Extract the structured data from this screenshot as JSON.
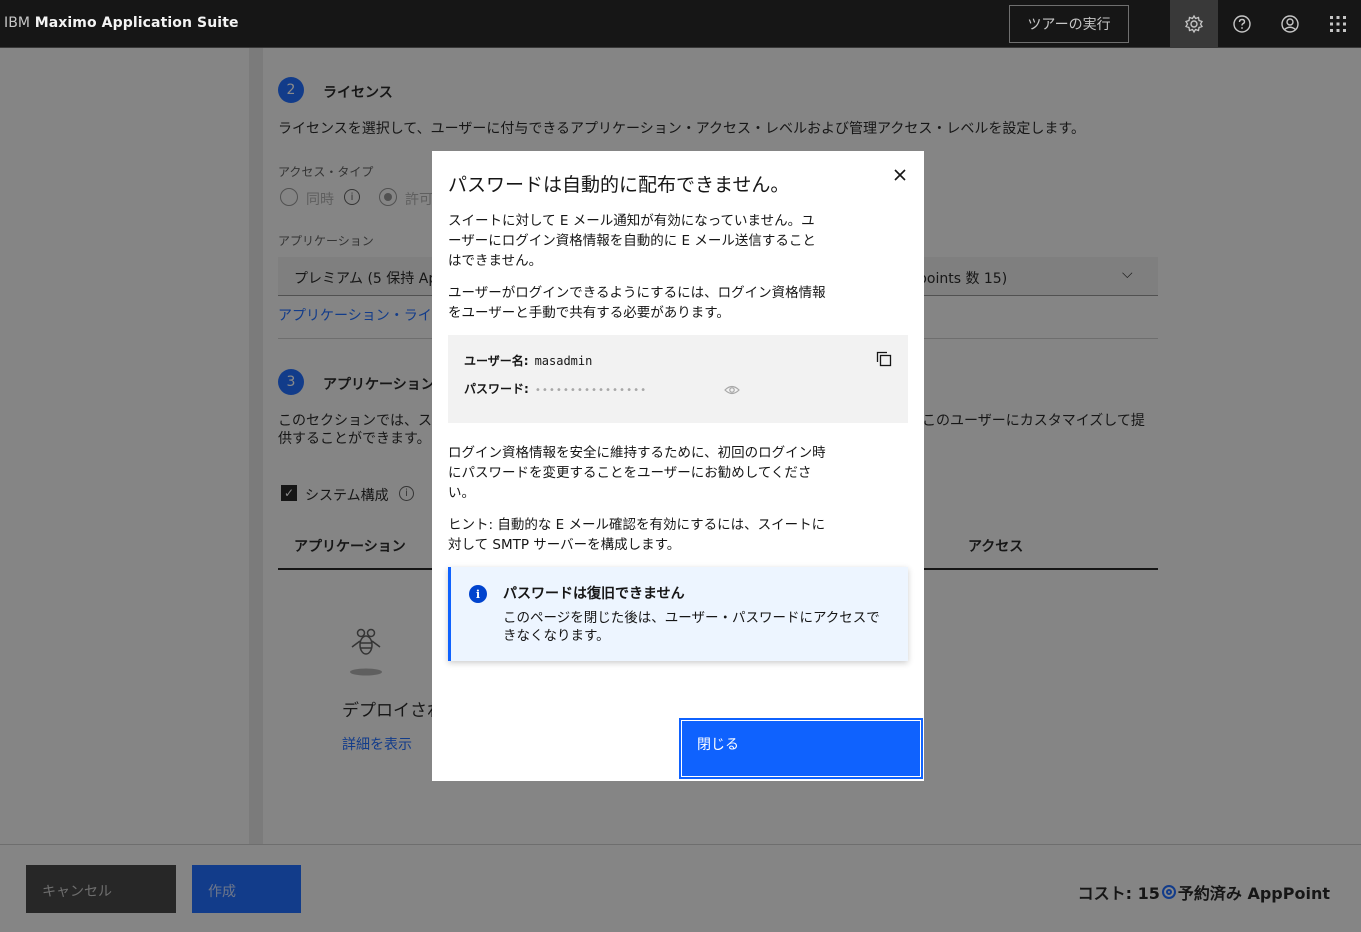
{
  "header": {
    "brand_prefix": "IBM",
    "brand_name": "Maximo Application Suite",
    "tour_button": "ツアーの実行"
  },
  "license_section": {
    "step": "2",
    "title": "ライセンス",
    "description": "ライセンスを選択して、ユーザーに付与できるアプリケーション・アクセス・レベルおよび管理アクセス・レベルを設定します。",
    "access_type_label": "アクセス・タイプ",
    "access_type_options": [
      "同時",
      "許可"
    ],
    "application_label": "アプリケーション",
    "application_value_left": "プレミアム (5 保持 Ap",
    "application_value_right": "points 数 15)",
    "app_license_link": "アプリケーション・ライ"
  },
  "application_section": {
    "step": "3",
    "title": "アプリケーション",
    "description_left_1": "このセクションでは、ス",
    "description_left_2": "供することができます。",
    "description_right": "このユーザーにカスタマイズして提",
    "system_config_label": "システム構成",
    "column_application": "アプリケーション",
    "column_access": "アクセス",
    "empty_title": "デプロイされ",
    "empty_link": "詳細を表示"
  },
  "footer": {
    "cancel": "キャンセル",
    "create": "作成",
    "cost": "コスト: 15",
    "cost_suffix": "予約済み AppPoint"
  },
  "modal": {
    "title": "パスワードは自動的に配布できません。",
    "p1": "スイートに対して E メール通知が有効になっていません。ユーザーにログイン資格情報を自動的に E メール送信することはできません。",
    "p2": "ユーザーがログインできるようにするには、ログイン資格情報をユーザーと手動で共有する必要があります。",
    "username_label": "ユーザー名:",
    "username_value": "masadmin",
    "password_label": "パスワード:",
    "password_mask": "••••••••••••••••",
    "p3": "ログイン資格情報を安全に維持するために、初回のログイン時にパスワードを変更することをユーザーにお勧めしてください。",
    "p4": "ヒント: 自動的な E メール確認を有効にするには、スイートに対して SMTP サーバーを構成します。",
    "notice_title": "パスワードは復旧できません",
    "notice_body": "このページを閉じた後は、ユーザー・パスワードにアクセスできなくなります。",
    "close_button": "閉じる"
  },
  "colors": {
    "primary": "#0f62fe",
    "header_bg": "#161616",
    "notice_bg": "#edf5ff"
  },
  "icons": [
    "settings-icon",
    "help-icon",
    "user-avatar-icon",
    "app-switcher-icon",
    "close-icon",
    "copy-icon",
    "eye-icon",
    "info-icon",
    "chevron-down-icon",
    "bee-icon"
  ]
}
